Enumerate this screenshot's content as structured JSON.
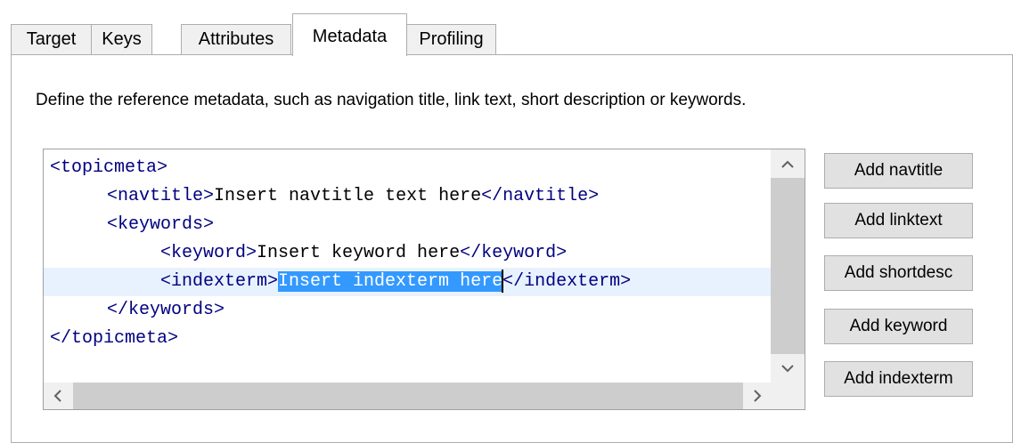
{
  "tabs": [
    {
      "label": "Target"
    },
    {
      "label": "Keys"
    },
    {
      "label": "Attributes"
    },
    {
      "label": "Metadata"
    },
    {
      "label": "Profiling"
    }
  ],
  "active_tab": "Metadata",
  "description": "Define the reference metadata, such as navigation title, link text, short description or keywords.",
  "editor": {
    "lines": [
      {
        "tag_open": "<topicmeta>"
      },
      {
        "tag_open": "<navtitle>",
        "text": "Insert navtitle text here",
        "tag_close": "</navtitle>"
      },
      {
        "tag_open": "<keywords>"
      },
      {
        "tag_open": "<keyword>",
        "text": "Insert keyword here",
        "tag_close": "</keyword>"
      },
      {
        "tag_open": "<indexterm>",
        "selected_text": "Insert indexterm here",
        "tag_close": "</indexterm>"
      },
      {
        "tag_open": "</keywords>"
      },
      {
        "tag_open": "</topicmeta>"
      }
    ]
  },
  "buttons": {
    "add_navtitle": "Add navtitle",
    "add_linktext": "Add linktext",
    "add_shortdesc": "Add shortdesc",
    "add_keyword": "Add keyword",
    "add_indexterm": "Add indexterm"
  },
  "icons": {
    "scroll_up": "chevron-up-icon",
    "scroll_down": "chevron-down-icon",
    "scroll_left": "chevron-left-icon",
    "scroll_right": "chevron-right-icon"
  },
  "colors": {
    "tag": "#000080",
    "selection": "#3399ff",
    "current_line": "#e8f2fe"
  }
}
